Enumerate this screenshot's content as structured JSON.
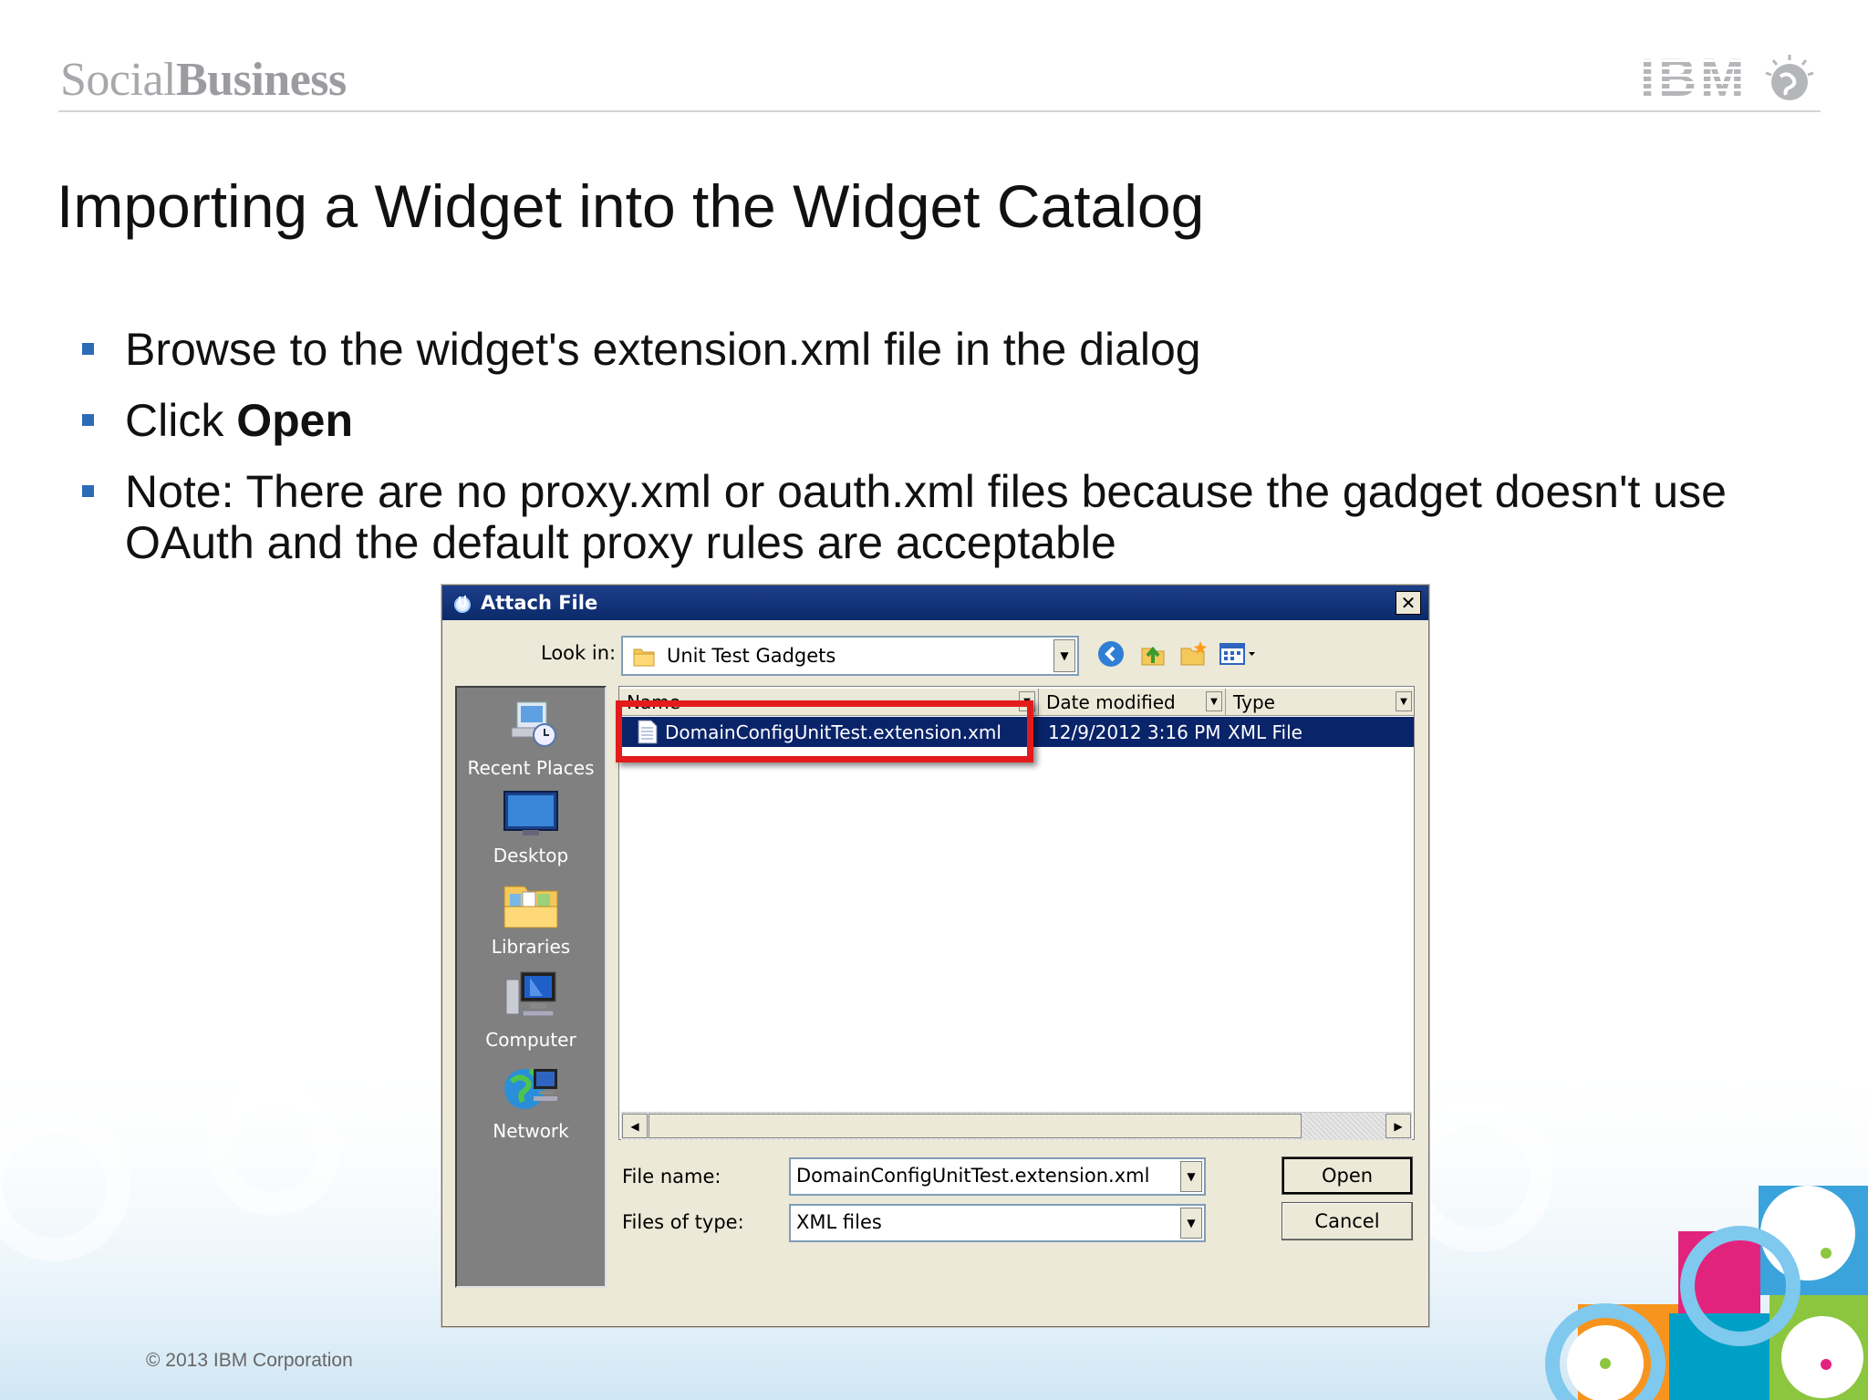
{
  "slide": {
    "brand_light": "Social",
    "brand_bold": "Business",
    "logo_text": "IBM",
    "title": "Importing a Widget into the Widget Catalog",
    "bullets": [
      {
        "text": "Browse to the widget's extension.xml file in the dialog"
      },
      {
        "prefix": "Click ",
        "bold": "Open"
      },
      {
        "text": "Note: There are no proxy.xml or oauth.xml files because the gadget doesn't use OAuth and the default proxy rules are acceptable"
      }
    ],
    "copyright": "© 2013 IBM Corporation",
    "bullet_color": "#2b6cb5"
  },
  "dialog": {
    "title": "Attach File",
    "close_glyph": "✕",
    "look_in_label": "Look in:",
    "look_in_value": "Unit Test Gadgets",
    "toolbar_icons": [
      "back-icon",
      "up-folder-icon",
      "new-folder-icon",
      "view-menu-icon"
    ],
    "places": [
      {
        "label": "Recent Places",
        "icon": "recent-places-icon"
      },
      {
        "label": "Desktop",
        "icon": "desktop-icon"
      },
      {
        "label": "Libraries",
        "icon": "libraries-icon"
      },
      {
        "label": "Computer",
        "icon": "computer-icon"
      },
      {
        "label": "Network",
        "icon": "network-icon"
      }
    ],
    "columns": [
      "Name",
      "Date modified",
      "Type"
    ],
    "files": [
      {
        "name": "DomainConfigUnitTest.extension.xml",
        "date": "12/9/2012 3:16 PM",
        "type": "XML File",
        "selected": true
      }
    ],
    "file_name_label": "File name:",
    "file_name_value": "DomainConfigUnitTest.extension.xml",
    "file_type_label": "Files of type:",
    "file_type_value": "XML files",
    "open_label": "Open",
    "cancel_label": "Cancel",
    "highlight_color": "#e31b1b",
    "selection_color": "#0a246a",
    "titlebar_color": "#0b2a6a"
  }
}
